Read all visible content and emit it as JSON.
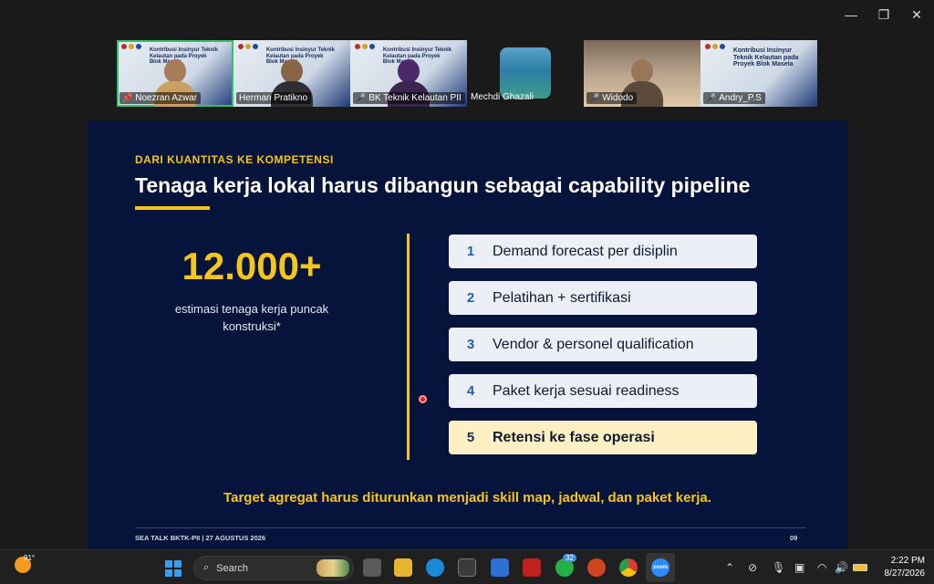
{
  "window": {
    "minimize": "—",
    "restore": "❐",
    "close": "✕"
  },
  "participants": [
    {
      "name": "Noezran Azwar",
      "muted": false,
      "pinned": true
    },
    {
      "name": "Herman Pratikno",
      "muted": false,
      "pinned": false
    },
    {
      "name": "BK Teknik Kelautan PII",
      "muted": true,
      "pinned": false
    },
    {
      "name": "Mechdi Ghazali",
      "muted": false,
      "pinned": false
    },
    {
      "name": "Widodo",
      "muted": true,
      "pinned": false
    },
    {
      "name": "Andry_P.S",
      "muted": true,
      "pinned": false
    }
  ],
  "mini_slide": {
    "title_a": "Kontribusi Insinyur Teknik Kelautan pada Proyek Blok Masela",
    "title_b": "Kontribusi Insinyur Teknik Kelautan pada Proyek Blok Masela"
  },
  "slide": {
    "kicker": "DARI KUANTITAS KE KOMPETENSI",
    "heading": "Tenaga kerja lokal harus dibangun sebagai capability pipeline",
    "big_number": "12.000+",
    "big_caption": "estimasi tenaga kerja puncak konstruksi*",
    "steps": [
      {
        "num": "1",
        "text": "Demand forecast per disiplin"
      },
      {
        "num": "2",
        "text": "Pelatihan + sertifikasi"
      },
      {
        "num": "3",
        "text": "Vendor & personel qualification"
      },
      {
        "num": "4",
        "text": "Paket kerja sesuai readiness"
      },
      {
        "num": "5",
        "text": "Retensi ke fase operasi"
      }
    ],
    "target": "Target agregat harus diturunkan menjadi skill map, jadwal, dan paket kerja.",
    "footer_left": "SEA TALK BKTK-PII | 27 AGUSTUS 2026",
    "footer_page": "09"
  },
  "taskbar": {
    "temperature": "91°",
    "search_placeholder": "Search",
    "whatsapp_badge": "32",
    "time": "2:22 PM",
    "date": "8/27/2026"
  },
  "colors": {
    "slide_bg": "#06133a",
    "accent_yellow": "#f5c518",
    "active_speaker": "#2ec26e"
  }
}
